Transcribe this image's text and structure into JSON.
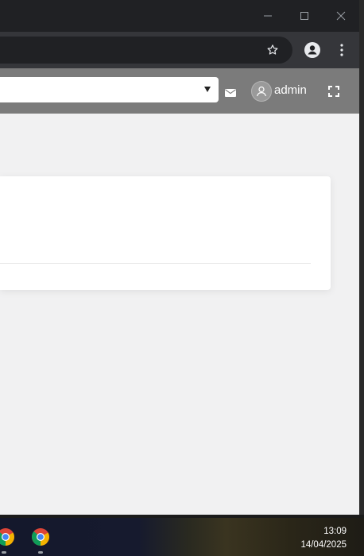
{
  "browser": {
    "window_controls": [
      "minimize-icon",
      "maximize-icon",
      "close-icon"
    ],
    "toolbar_icons": [
      "bookmark-star-icon",
      "profile-icon",
      "kebab-menu-icon"
    ]
  },
  "app": {
    "header_bg": "#7b7b7b",
    "user": {
      "name": "admin"
    },
    "icons": [
      "mail-icon",
      "user-avatar-icon",
      "fullscreen-icon"
    ]
  },
  "taskbar": {
    "apps": [
      "chrome-icon",
      "chrome-icon"
    ],
    "time": "13:09",
    "date": "14/04/2025"
  }
}
